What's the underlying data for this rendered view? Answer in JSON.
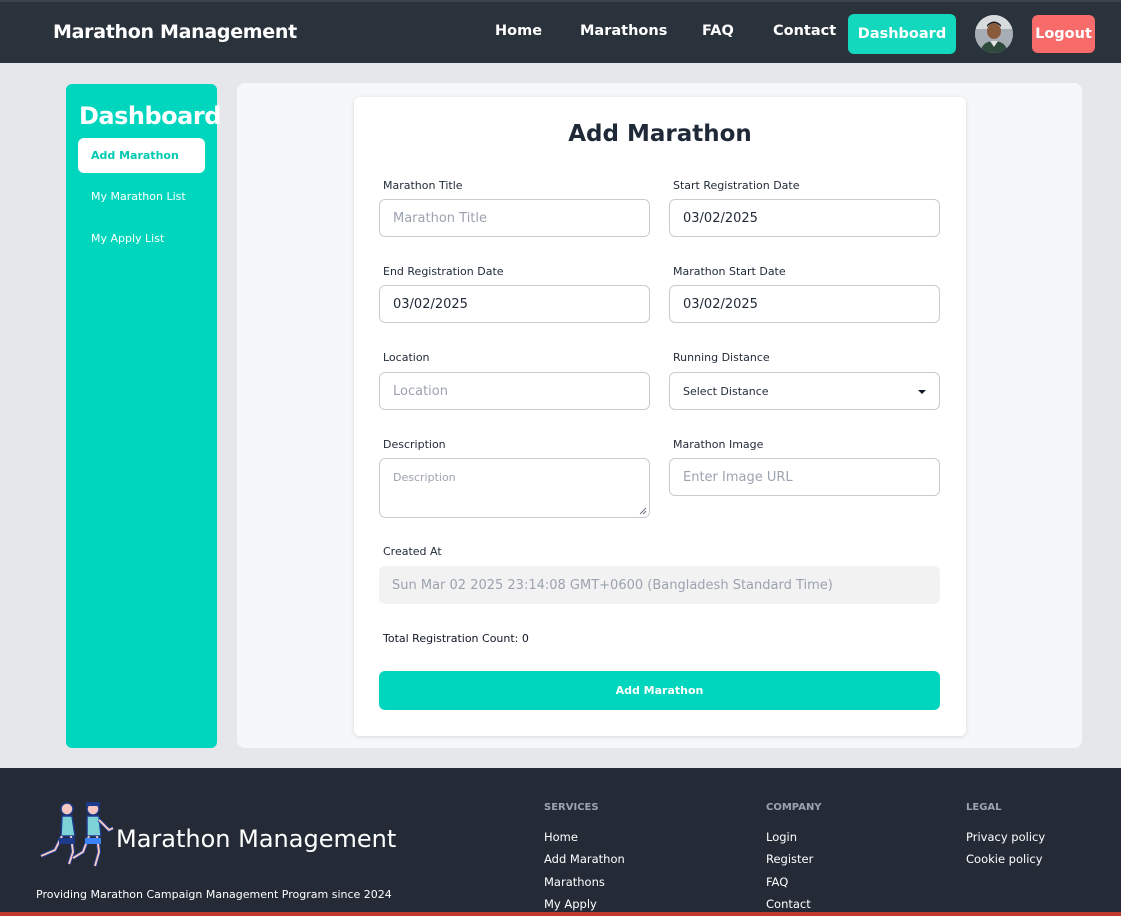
{
  "navbar": {
    "brand": "Marathon Management",
    "links": [
      "Home",
      "Marathons",
      "FAQ",
      "Contact"
    ],
    "dashboard_button": "Dashboard",
    "logout_button": "Logout",
    "avatar_icon": "user-avatar"
  },
  "sidebar": {
    "title": "Dashboard",
    "items": [
      {
        "label": "Add Marathon",
        "active": true
      },
      {
        "label": "My Marathon List",
        "active": false
      },
      {
        "label": "My Apply List",
        "active": false
      }
    ]
  },
  "form": {
    "title": "Add Marathon",
    "fields": {
      "title": {
        "label": "Marathon Title",
        "placeholder": "Marathon Title",
        "value": ""
      },
      "start_registration": {
        "label": "Start Registration Date",
        "value": "03/02/2025"
      },
      "end_registration": {
        "label": "End Registration Date",
        "value": "03/02/2025"
      },
      "marathon_start": {
        "label": "Marathon Start Date",
        "value": "03/02/2025"
      },
      "location": {
        "label": "Location",
        "placeholder": "Location",
        "value": ""
      },
      "distance": {
        "label": "Running Distance",
        "value": "Select Distance"
      },
      "description": {
        "label": "Description",
        "placeholder": "Description",
        "value": ""
      },
      "image": {
        "label": "Marathon Image",
        "placeholder": "Enter Image URL",
        "value": ""
      },
      "created_at": {
        "label": "Created At",
        "value": "Sun Mar 02 2025 23:14:08 GMT+0600 (Bangladesh Standard Time)"
      }
    },
    "registration_count": "Total Registration Count: 0",
    "submit_label": "Add Marathon"
  },
  "footer": {
    "brand": "Marathon Management",
    "tagline": "Providing Marathon Campaign Management Program since 2024",
    "columns": [
      {
        "heading": "SERVICES",
        "links": [
          "Home",
          "Add Marathon",
          "Marathons",
          "My Apply"
        ]
      },
      {
        "heading": "COMPANY",
        "links": [
          "Login",
          "Register",
          "FAQ",
          "Contact"
        ]
      },
      {
        "heading": "LEGAL",
        "links": [
          "Privacy policy",
          "Cookie policy"
        ]
      }
    ]
  },
  "colors": {
    "accent": "#00d6be",
    "navbar": "#2a323c",
    "logout": "#f76b6b",
    "footer": "#242a36"
  }
}
